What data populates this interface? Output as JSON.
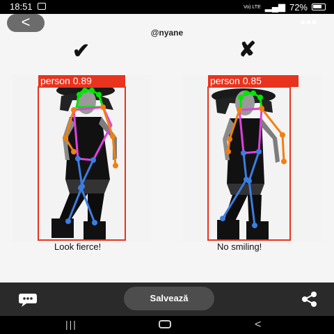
{
  "status_bar": {
    "time": "18:51",
    "network": "Vo) LTE",
    "battery": "72%"
  },
  "header": {
    "back_label": "<",
    "more_label": "•••",
    "username": "@nyane"
  },
  "post": {
    "left_mark": "✔",
    "right_mark": "✘",
    "left_detection": "person 0.89",
    "right_detection": "person 0.85",
    "left_caption": "Look fierce!",
    "right_caption": "No smiling!"
  },
  "bottom_bar": {
    "save_label": "Salvează"
  },
  "nav": {
    "recents": "|||",
    "back": "<"
  },
  "colors": {
    "detection_box": "#e8331e",
    "pose_head": "#00e600",
    "pose_torso": "#e040e0",
    "pose_arms": "#f08010",
    "pose_legs": "#3c7de0"
  }
}
